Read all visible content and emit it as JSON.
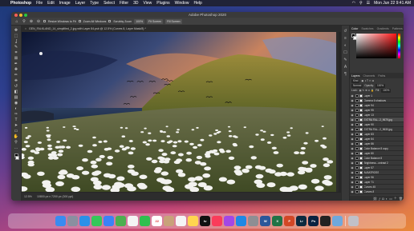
{
  "menubar": {
    "app_name": "Photoshop",
    "items": [
      "File",
      "Edit",
      "Image",
      "Layer",
      "Type",
      "Select",
      "Filter",
      "3D",
      "View",
      "Plugins",
      "Window",
      "Help"
    ],
    "datetime": "Mon Jun 22  9:41 AM"
  },
  "window": {
    "title": "Adobe Photoshop 2020",
    "doc_tab": "GEN_FALKLAND_14_simplified_2.jpg with Layer 84.psb @ 12.5% (Curves 8, Layer Mask/8) *"
  },
  "options_bar": {
    "resize_windows": "Resize Windows to Fit",
    "zoom_all": "Zoom All Windows",
    "scrubby_zoom": "Scrubby Zoom",
    "zoom_level": "100%",
    "fit_screen": "Fit Screen",
    "fill_screen": "Fill Screen"
  },
  "tools": [
    "move-icon",
    "marquee-icon",
    "lasso-icon",
    "quick-select-icon",
    "crop-icon",
    "frame-icon",
    "eyedropper-icon",
    "healing-icon",
    "brush-icon",
    "stamp-icon",
    "history-brush-icon",
    "eraser-icon",
    "gradient-icon",
    "blur-icon",
    "dodge-icon",
    "pen-icon",
    "type-icon",
    "path-select-icon",
    "shape-icon",
    "hand-icon",
    "zoom-icon",
    "more-tools-icon"
  ],
  "tool_glyphs": [
    "✥",
    "⬚",
    "ʆ",
    "✎",
    "⌗",
    "⊠",
    "✒",
    "✚",
    "✏",
    "⎈",
    "↺",
    "◧",
    "▤",
    "◉",
    "◐",
    "✑",
    "T",
    "➤",
    "▭",
    "✋",
    "⚲",
    "…"
  ],
  "status_bar": {
    "zoom": "12.5%",
    "doc_size": "10800 px x 7200 px (300 ppi)"
  },
  "panels": {
    "color_tabs": [
      "Color",
      "Swatches",
      "Gradients",
      "Patterns"
    ],
    "layers_tabs": [
      "Layers",
      "Channels",
      "Paths"
    ],
    "kind_label": "Kind",
    "blend_mode": "Normal",
    "opacity_label": "Opacity:",
    "opacity_value": "100%",
    "lock_label": "Lock:",
    "fill_label": "Fill:",
    "fill_value": "100%",
    "layers": [
      {
        "name": "Layer 1",
        "selected": false
      },
      {
        "name": "Gamma 6 shadows",
        "selected": false
      },
      {
        "name": "Layer 94",
        "selected": false
      },
      {
        "name": "Layer 95",
        "selected": false
      },
      {
        "name": "Layer 13",
        "selected": false
      },
      {
        "name": "EXTRA FAL...2_9679.jpg",
        "selected": true
      },
      {
        "name": "Layer 90",
        "selected": false
      },
      {
        "name": "EXTRA FAL...2_9630.jpg",
        "selected": false
      },
      {
        "name": "Layer 83",
        "selected": false
      },
      {
        "name": "Layer 84",
        "selected": false
      },
      {
        "name": "Layer 86",
        "selected": false
      },
      {
        "name": "Color Balance 8 copy",
        "selected": false
      },
      {
        "name": "Layer 80",
        "selected": false
      },
      {
        "name": "Color Balance 8",
        "selected": false
      },
      {
        "name": "Brightness...ontrast 2",
        "selected": false
      },
      {
        "name": "Layer 57",
        "selected": false
      },
      {
        "name": "ALBATROSS",
        "selected": false
      },
      {
        "name": "Layer 96",
        "selected": false
      },
      {
        "name": "Layer 71",
        "selected": false
      },
      {
        "name": "Curves 45",
        "selected": false
      },
      {
        "name": "Curves 8",
        "selected": false
      }
    ]
  },
  "dock": [
    {
      "name": "Finder",
      "label": "",
      "color": "#3a8bf0"
    },
    {
      "name": "Launchpad",
      "label": "",
      "color": "#8a8fa0"
    },
    {
      "name": "Safari",
      "label": "",
      "color": "#2a90e8"
    },
    {
      "name": "Messages",
      "label": "",
      "color": "#34c759"
    },
    {
      "name": "Mail",
      "label": "",
      "color": "#3b82f6"
    },
    {
      "name": "Maps",
      "label": "",
      "color": "#4caf50"
    },
    {
      "name": "Photos",
      "label": "",
      "color": "#f4f4f4"
    },
    {
      "name": "FaceTime",
      "label": "",
      "color": "#2fbf4f"
    },
    {
      "name": "Calendar",
      "label": "22",
      "color": "#ffffff"
    },
    {
      "name": "Contacts",
      "label": "",
      "color": "#c8a27a"
    },
    {
      "name": "Reminders",
      "label": "",
      "color": "#f5f5f5"
    },
    {
      "name": "Notes",
      "label": "",
      "color": "#ffd54f"
    },
    {
      "name": "TV",
      "label": "tv",
      "color": "#111111"
    },
    {
      "name": "Music",
      "label": "",
      "color": "#fa3c5a"
    },
    {
      "name": "Podcasts",
      "label": "",
      "color": "#a347e6"
    },
    {
      "name": "App Store",
      "label": "",
      "color": "#1e88e5"
    },
    {
      "name": "System Preferences",
      "label": "",
      "color": "#8e8e93"
    },
    {
      "name": "Word",
      "label": "W",
      "color": "#2b579a"
    },
    {
      "name": "Excel",
      "label": "X",
      "color": "#217346"
    },
    {
      "name": "PowerPoint",
      "label": "P",
      "color": "#d24726"
    },
    {
      "name": "Lightroom",
      "label": "Lr",
      "color": "#0d2a3f"
    },
    {
      "name": "Photoshop",
      "label": "Ps",
      "color": "#0a2240"
    },
    {
      "name": "Final Cut",
      "label": "",
      "color": "#222222"
    },
    {
      "name": "Preview",
      "label": "",
      "color": "#6fa8dc"
    },
    {
      "name": "Trash",
      "label": "",
      "color": "#c0c0c8"
    }
  ]
}
